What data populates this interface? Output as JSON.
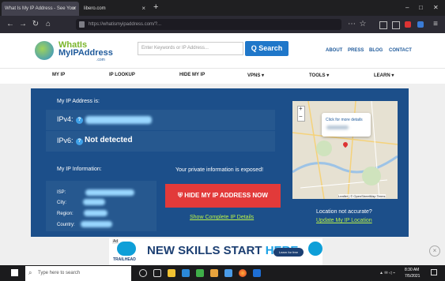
{
  "browser": {
    "tabs": [
      {
        "label": "What Is My IP Address - See Your"
      },
      {
        "label": "libero.com"
      }
    ],
    "new_tab": "+",
    "url": "https://whatismyipaddress.com/?...",
    "window_controls": {
      "minimize": "–",
      "maximize": "□",
      "close": "✕"
    }
  },
  "site": {
    "logo_line1": "WhatIs",
    "logo_line2": "MyIPAddress",
    "logo_sub": ".com",
    "search_placeholder": "Enter Keywords or IP Address...",
    "search_button": "Q Search",
    "top_links": [
      "ABOUT",
      "PRESS",
      "BLOG",
      "CONTACT"
    ],
    "nav": [
      "MY IP",
      "IP LOOKUP",
      "HIDE MY IP",
      "VPNS ▾",
      "TOOLS ▾",
      "LEARN ▾"
    ]
  },
  "main": {
    "my_ip_heading": "My IP Address is:",
    "ipv4_label": "IPv4:",
    "ipv6_label": "IPv6:",
    "ipv6_value": "Not detected",
    "info_heading": "My IP Information:",
    "info_labels": [
      "ISP:",
      "City:",
      "Region:",
      "Country:"
    ],
    "exposed_text": "Your private information is exposed!",
    "hide_button": "HIDE MY IP ADDRESS NOW",
    "show_details": "Show Complete IP Details",
    "location_question": "Location not accurate?",
    "update_location": "Update My IP Location",
    "map_popup": "Click for more details",
    "map_attribution": "Leaflet | © OpenStreetMap Terms",
    "zoom_in": "+",
    "zoom_out": "−"
  },
  "ad": {
    "brand": "TRAILHEAD",
    "headline_part1": "NEW SKILLS START",
    "headline_part2": "HERE.",
    "cta": "Learn for free"
  },
  "taskbar": {
    "search_placeholder": "Type here to search",
    "time": "8:30 AM",
    "date": "7/5/2021"
  },
  "colors": {
    "panel": "#1c4f8a",
    "accent_blue": "#1f77c9",
    "hide_button": "#e23a3a",
    "link_green": "#b9f047"
  }
}
